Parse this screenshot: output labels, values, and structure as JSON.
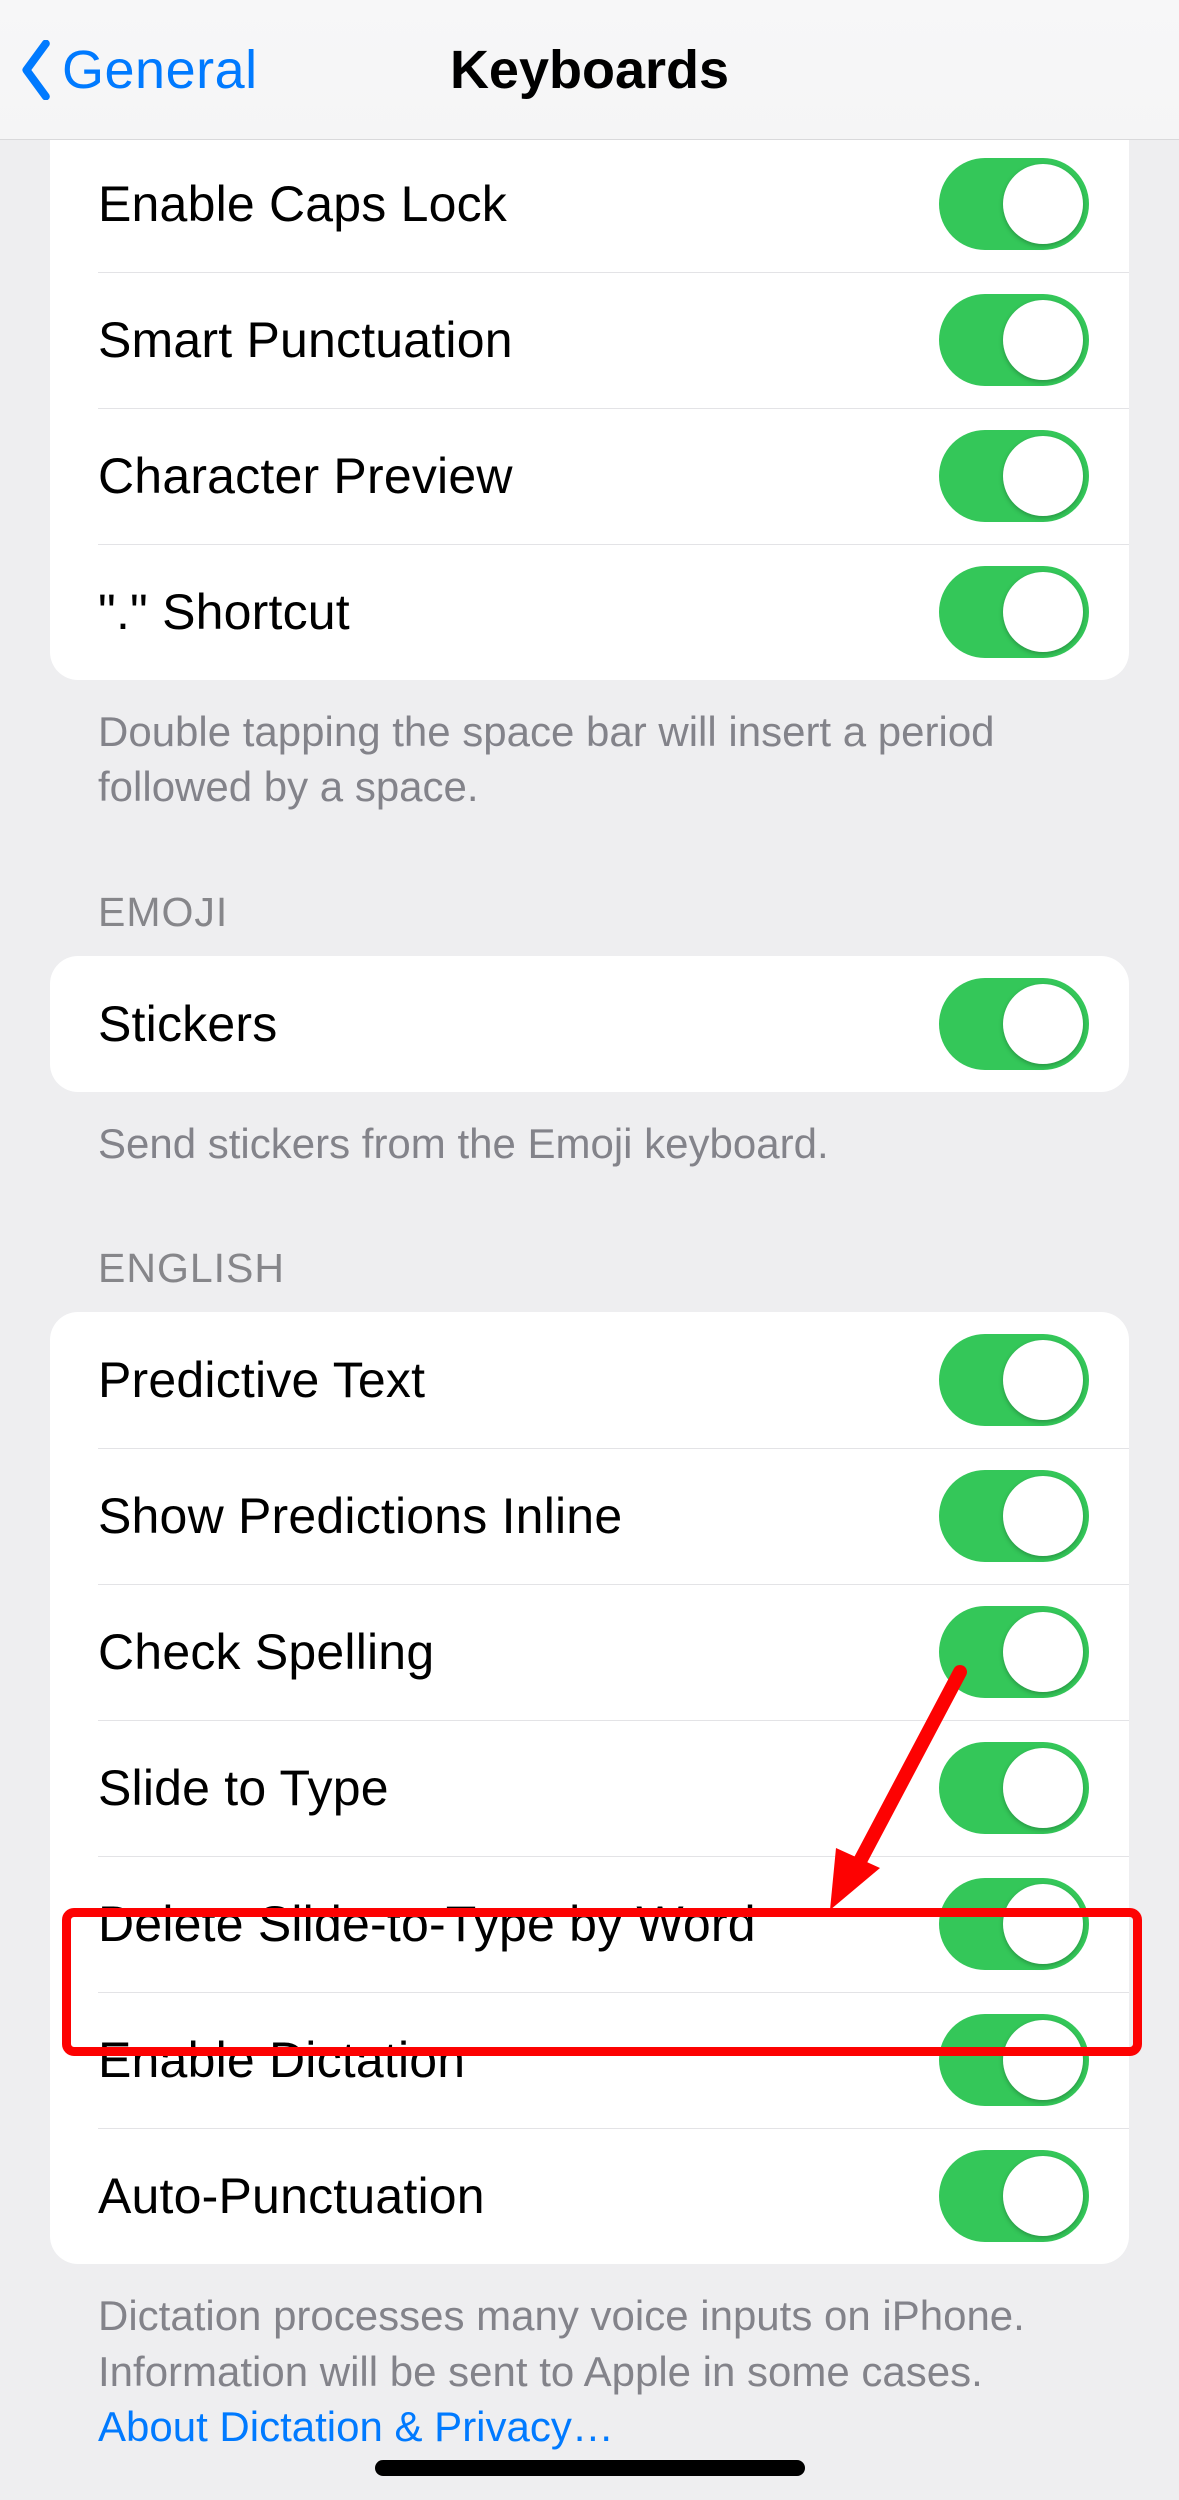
{
  "nav": {
    "back_label": "General",
    "title": "Keyboards"
  },
  "group1": {
    "rows": [
      {
        "label": "Enable Caps Lock"
      },
      {
        "label": "Smart Punctuation"
      },
      {
        "label": "Character Preview"
      },
      {
        "label": "\".\" Shortcut"
      }
    ],
    "footer": "Double tapping the space bar will insert a period followed by a space."
  },
  "group2": {
    "header": "EMOJI",
    "rows": [
      {
        "label": "Stickers"
      }
    ],
    "footer": "Send stickers from the Emoji keyboard."
  },
  "group3": {
    "header": "ENGLISH",
    "rows": [
      {
        "label": "Predictive Text"
      },
      {
        "label": "Show Predictions Inline"
      },
      {
        "label": "Check Spelling"
      },
      {
        "label": "Slide to Type"
      },
      {
        "label": "Delete Slide-to-Type by Word"
      },
      {
        "label": "Enable Dictation"
      },
      {
        "label": "Auto-Punctuation"
      }
    ],
    "footer_plain": "Dictation processes many voice inputs on iPhone. Information will be sent to Apple in some cases. ",
    "footer_link": "About Dictation & Privacy…"
  }
}
